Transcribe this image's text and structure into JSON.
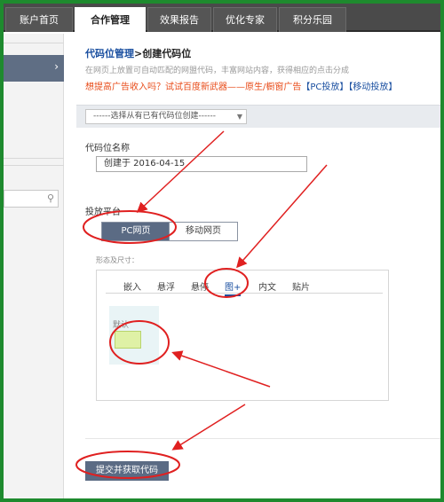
{
  "topnav": {
    "tabs": [
      {
        "label": "账户首页"
      },
      {
        "label": "合作管理"
      },
      {
        "label": "效果报告"
      },
      {
        "label": "优化专家"
      },
      {
        "label": "积分乐园"
      }
    ],
    "active_index": 1
  },
  "sidebar": {
    "chevron": "›",
    "search_icon": "search-icon"
  },
  "main": {
    "breadcrumb_link": "代码位管理",
    "breadcrumb_current": ">创建代码位",
    "description": "在网页上放置可自动匹配的网盟代码，丰富网站内容，获得相应的点击分成",
    "promo_text": "想提高广告收入吗？试试百度新武器——原生/橱窗广告",
    "promo_link_pc": "【PC投放】",
    "promo_link_mobile": "【移动投放】",
    "select_placeholder": "------选择从有已有代码位创建------",
    "name_label": "代码位名称",
    "name_value": "创建于 2016-04-15",
    "platform_label": "投放平台",
    "platform_pc": "PC网页",
    "platform_mobile": "移动网页",
    "form_label": "形态及尺寸：",
    "panel_tabs": [
      {
        "label": "嵌入"
      },
      {
        "label": "悬浮"
      },
      {
        "label": "悬停"
      },
      {
        "label": "图+"
      },
      {
        "label": "内文"
      },
      {
        "label": "贴片"
      }
    ],
    "panel_active_tab": 3,
    "thumb_label": "默认",
    "submit_label": "提交并获取代码"
  },
  "colors": {
    "frame_border": "#1e8a2e",
    "nav_bg": "#4a4a4a",
    "accent_blue": "#1a4fa0",
    "promo_orange": "#e84c1a",
    "button_slate": "#5b6b84",
    "annotation_red": "#e02020"
  }
}
